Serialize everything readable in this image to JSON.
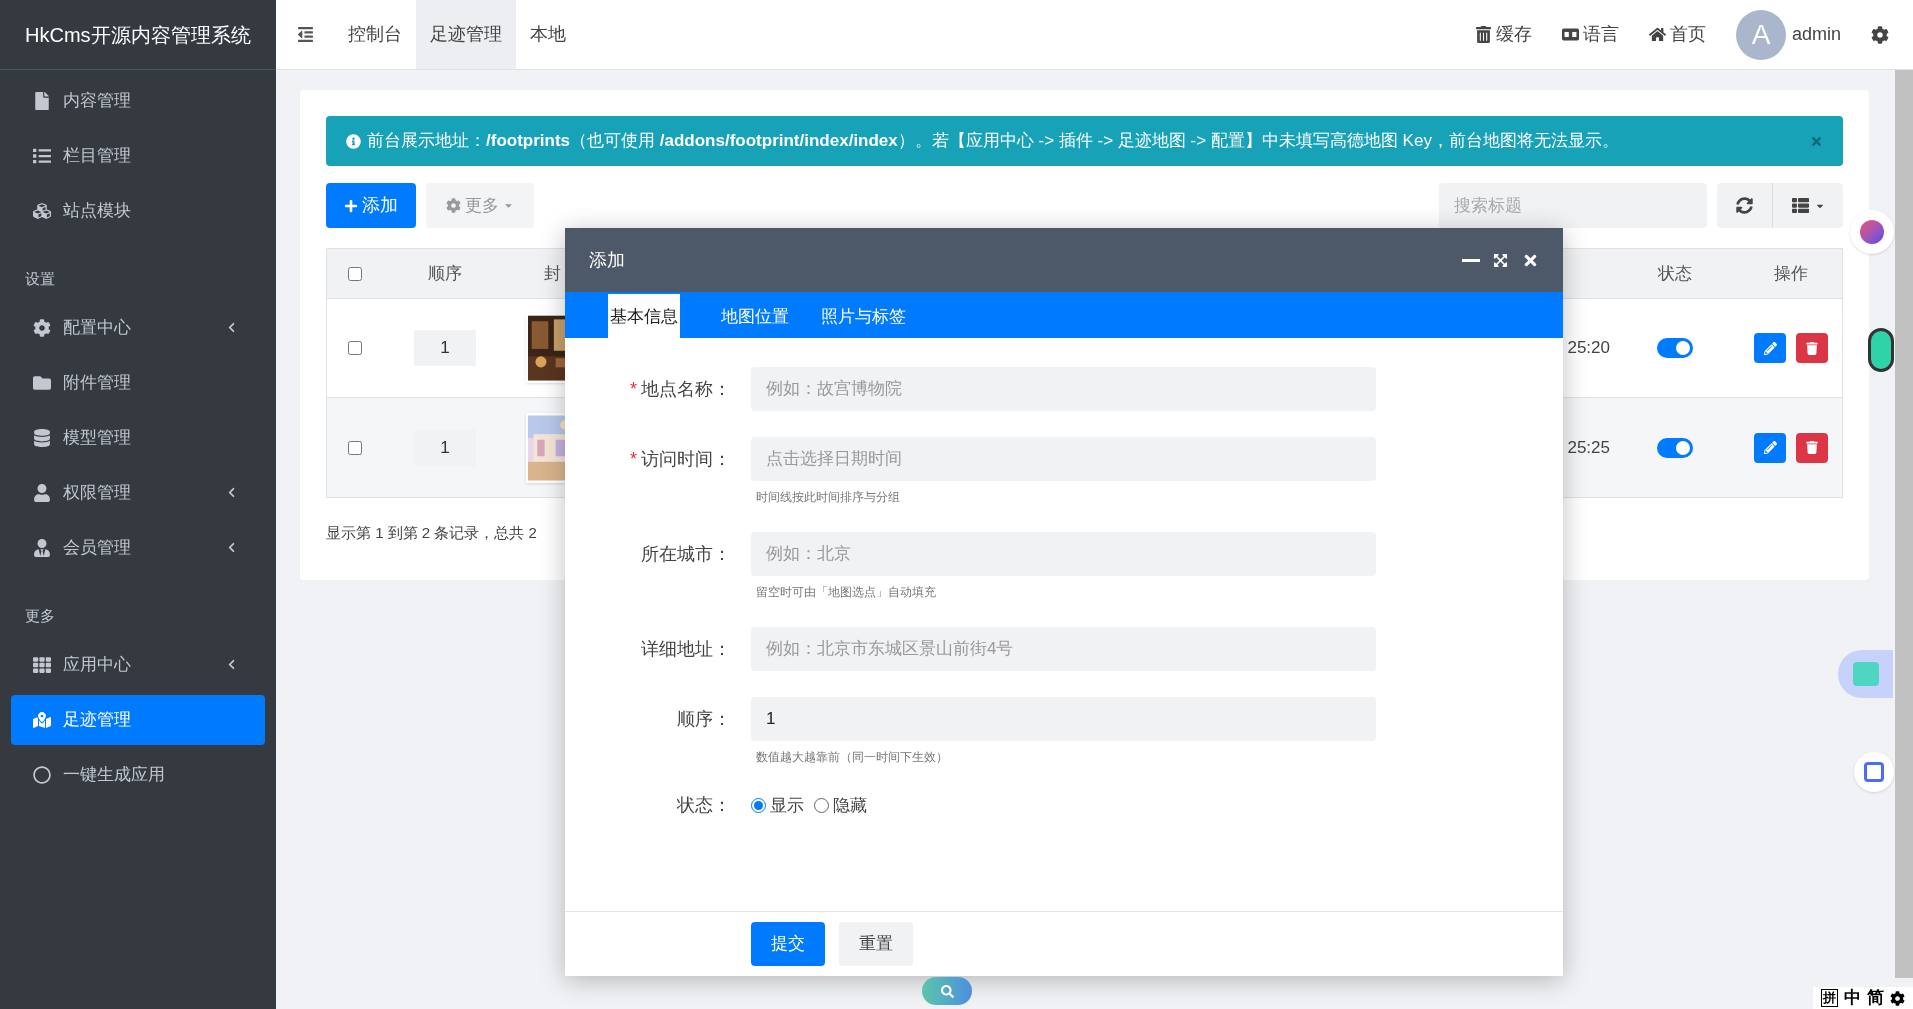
{
  "sidebar": {
    "title": "HkCms开源内容管理系统",
    "items": [
      {
        "kind": "item",
        "label": "内容管理",
        "collapsible": false,
        "selected": false
      },
      {
        "kind": "item",
        "label": "栏目管理",
        "collapsible": false,
        "selected": false
      },
      {
        "kind": "item",
        "label": "站点模块",
        "collapsible": false,
        "selected": false
      },
      {
        "kind": "section",
        "label": "设置"
      },
      {
        "kind": "item",
        "label": "配置中心",
        "collapsible": true,
        "selected": false
      },
      {
        "kind": "item",
        "label": "附件管理",
        "collapsible": false,
        "selected": false
      },
      {
        "kind": "item",
        "label": "模型管理",
        "collapsible": false,
        "selected": false
      },
      {
        "kind": "item",
        "label": "权限管理",
        "collapsible": true,
        "selected": false
      },
      {
        "kind": "item",
        "label": "会员管理",
        "collapsible": true,
        "selected": false
      },
      {
        "kind": "section",
        "label": "更多"
      },
      {
        "kind": "item",
        "label": "应用中心",
        "collapsible": true,
        "selected": false
      },
      {
        "kind": "item",
        "label": "足迹管理",
        "collapsible": false,
        "selected": true
      },
      {
        "kind": "item",
        "label": "一键生成应用",
        "collapsible": false,
        "selected": false
      }
    ]
  },
  "top_bar": {
    "tabs": [
      {
        "label": "控制台",
        "selected": false
      },
      {
        "label": "足迹管理",
        "selected": true
      },
      {
        "label": "本地",
        "selected": false
      }
    ],
    "links": [
      "缓存",
      "语言",
      "首页"
    ],
    "avatar": "A",
    "user": "admin"
  },
  "alert": {
    "text": "前台展示地址：**/footprints**（也可使用 **/addons/footprint/index/index**）。若【应用中心 -> 插件 -> 足迹地图 -> 配置】中未填写高德地图 Key，前台地图将无法显示。"
  },
  "toolbar": {
    "add": "添加",
    "more": "更多",
    "search": {
      "placeholder": "搜索标题"
    }
  },
  "table": {
    "select_all_checked": false,
    "columns": [
      "顺序",
      "封",
      "状态",
      "操作"
    ],
    "rows": [
      {
        "checked": false,
        "order": "1",
        "time": "25:20",
        "on": true
      },
      {
        "checked": false,
        "order": "1",
        "time": "25:25",
        "on": true
      }
    ],
    "footer": "显示第 1 到第 2 条记录，总共 2"
  },
  "dialog": {
    "title": "添加",
    "tabs": [
      {
        "label": "基本信息",
        "selected": true
      },
      {
        "label": "地图位置",
        "selected": false
      },
      {
        "label": "照片与标签",
        "selected": false
      }
    ],
    "fields": [
      {
        "label": "地点名称：",
        "required_mark": "*",
        "placeholder": "例如：故宫博物院"
      },
      {
        "label": "访问时间：",
        "required_mark": "*",
        "placeholder": "点击选择日期时间",
        "help": "时间线按此时间排序与分组"
      },
      {
        "label": "所在城市：",
        "placeholder": "例如：北京",
        "help": "留空时可由「地图选点」自动填充"
      },
      {
        "label": "详细地址：",
        "placeholder": "例如：北京市东城区景山前街4号"
      },
      {
        "label": "顺序：",
        "value": "1",
        "help": "数值越大越靠前（同一时间下生效）"
      }
    ],
    "status": {
      "label": "状态：",
      "options": [
        {
          "label": "显示",
          "selected": true
        },
        {
          "label": "隐藏",
          "selected": false
        }
      ]
    },
    "buttons": [
      "提交",
      "重置"
    ]
  },
  "ime_bar": [
    "拼",
    "中",
    "简"
  ]
}
